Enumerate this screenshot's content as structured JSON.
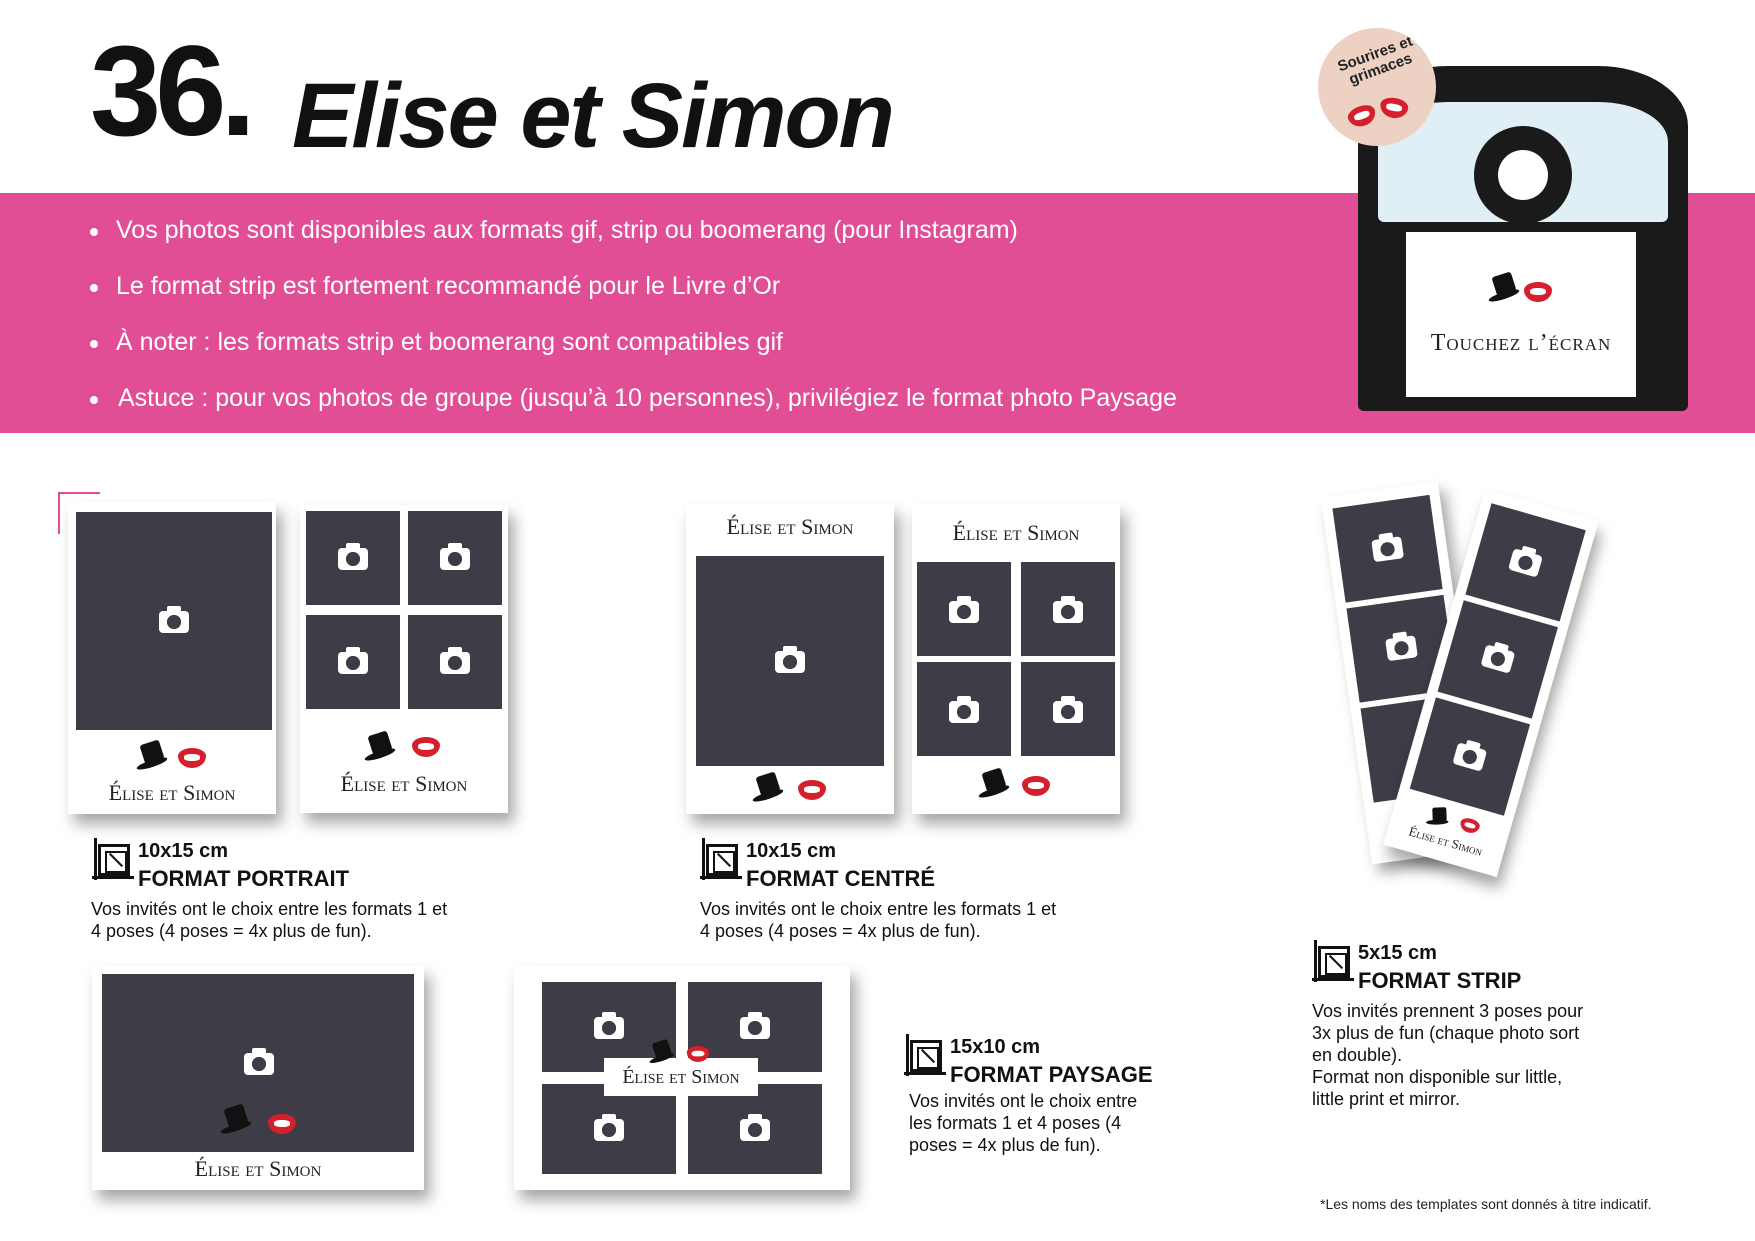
{
  "title": {
    "number": "36.",
    "name": "Elise et Simon"
  },
  "bullets": [
    "Vos photos sont disponibles aux formats gif, strip ou boomerang (pour Instagram)",
    "Le format strip est fortement recommandé pour le Livre d’Or",
    "À noter : les formats strip et boomerang sont compatibles gif",
    "Astuce : pour vos photos de groupe (jusqu’à 10 personnes), privilégiez le format photo Paysage"
  ],
  "device": {
    "screen_text": "Touchez l’écran",
    "badge": "Sourires et grimaces"
  },
  "template_name": "Élise et Simon",
  "formats": {
    "portrait": {
      "size": "10x15 cm",
      "name": "FORMAT PORTRAIT",
      "desc": "Vos invités ont le choix entre les formats 1 et\n4 poses (4 poses = 4x plus de fun)."
    },
    "centre": {
      "size": "10x15 cm",
      "name": "FORMAT CENTRÉ",
      "desc": "Vos invités ont le choix entre les formats 1 et\n4 poses (4 poses = 4x plus de fun)."
    },
    "paysage": {
      "size": "15x10 cm",
      "name": "FORMAT PAYSAGE",
      "desc": "Vos invités ont le choix entre\nles formats 1 et 4 poses (4\nposes = 4x plus de fun)."
    },
    "strip": {
      "size": "5x15 cm",
      "name": "FORMAT STRIP",
      "desc": "Vos invités prennent 3 poses pour\n3x plus de fun (chaque photo sort\nen double).\nFormat non disponible sur little,\nlittle print et mirror."
    }
  },
  "footnote": "*Les noms des templates sont donnés à titre indicatif.",
  "colors": {
    "pink": "#e14e96",
    "photo": "#3d3c47",
    "device": "#1a1a1a"
  }
}
